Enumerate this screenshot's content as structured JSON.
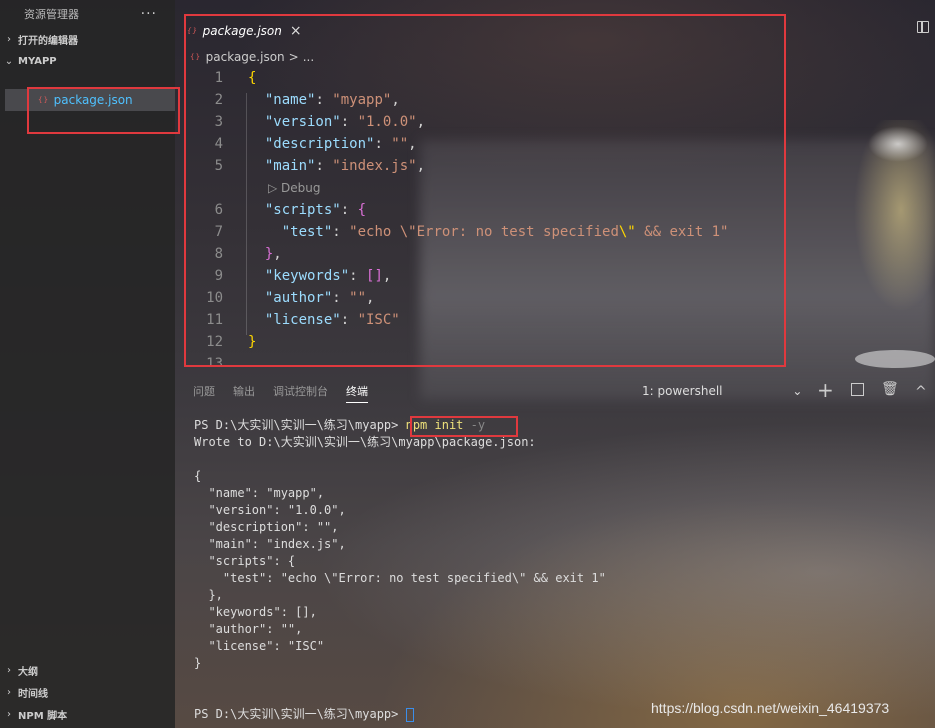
{
  "sidebar": {
    "title": "资源管理器",
    "more": "···",
    "open_editors": "打开的编辑器",
    "project": "MYAPP",
    "file": "package.json",
    "outline": "大纲",
    "timeline": "时间线",
    "npm_scripts": "NPM 脚本"
  },
  "editor": {
    "tab_label": "package.json",
    "tab_close": "×",
    "breadcrumb_file": "package.json",
    "breadcrumb_sep": ">",
    "breadcrumb_more": "...",
    "codelens": "▷ Debug",
    "lines": [
      {
        "n": "1"
      },
      {
        "n": "2"
      },
      {
        "n": "3"
      },
      {
        "n": "4"
      },
      {
        "n": "5"
      },
      {
        "n": "6"
      },
      {
        "n": "7"
      },
      {
        "n": "8"
      },
      {
        "n": "9"
      },
      {
        "n": "10"
      },
      {
        "n": "11"
      },
      {
        "n": "12"
      },
      {
        "n": "13"
      }
    ],
    "code": {
      "open": "{",
      "name_key": "\"name\"",
      "name_val": "\"myapp\"",
      "version_key": "\"version\"",
      "version_val": "\"1.0.0\"",
      "description_key": "\"description\"",
      "description_val": "\"\"",
      "main_key": "\"main\"",
      "main_val": "\"index.js\"",
      "scripts_key": "\"scripts\"",
      "scripts_open": "{",
      "test_key": "\"test\"",
      "test_val_1": "\"echo \\\"Error: no test specified",
      "test_val_esc": "\\\"",
      "test_val_2": " && exit 1\"",
      "scripts_close": "}",
      "keywords_key": "\"keywords\"",
      "keywords_val": "[]",
      "author_key": "\"author\"",
      "author_val": "\"\"",
      "license_key": "\"license\"",
      "license_val": "\"ISC\"",
      "close": "}"
    }
  },
  "panel": {
    "tabs": [
      "问题",
      "输出",
      "调试控制台",
      "终端"
    ],
    "shell": "1: powershell",
    "shell_chevron": "⌄",
    "add_icon": "+",
    "trash_icon": "🗑",
    "up_icon": "^"
  },
  "terminal": {
    "prompt": "PS D:\\大实训\\实训一\\练习\\myapp> ",
    "command": "npm init",
    "flag": " -y",
    "wrote": "Wrote to D:\\大实训\\实训一\\练习\\myapp\\package.json:",
    "json": [
      "{",
      "  \"name\": \"myapp\",",
      "  \"version\": \"1.0.0\",",
      "  \"description\": \"\",",
      "  \"main\": \"index.js\",",
      "  \"scripts\": {",
      "    \"test\": \"echo \\\"Error: no test specified\\\" && exit 1\"",
      "  },",
      "  \"keywords\": [],",
      "  \"author\": \"\",",
      "  \"license\": \"ISC\"",
      "}"
    ],
    "final_prompt": "PS D:\\大实训\\实训一\\练习\\myapp> "
  },
  "watermark": "https://blog.csdn.net/weixin_46419373",
  "colors": {
    "highlight": "#e0393e",
    "key": "#9cdcfe",
    "string": "#ce9178"
  }
}
